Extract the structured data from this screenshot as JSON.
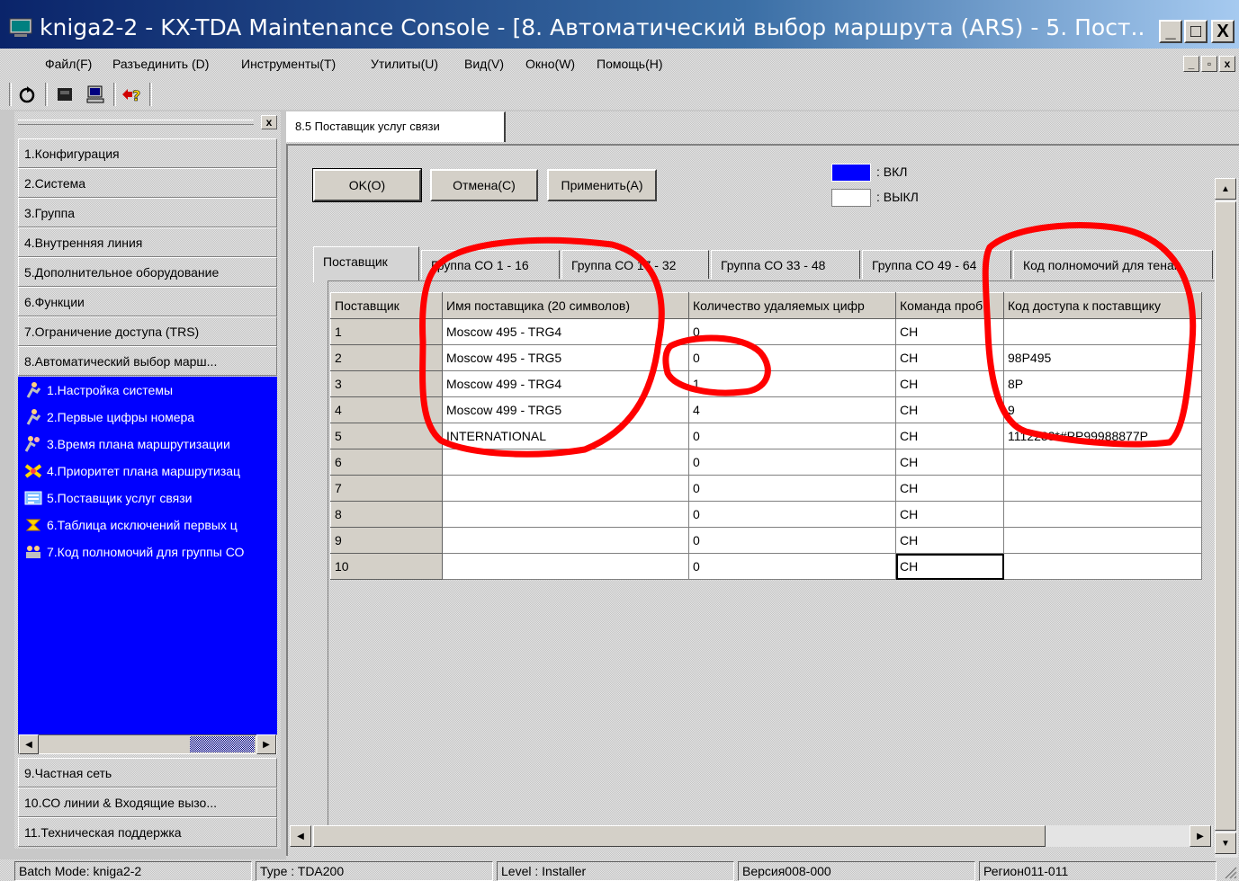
{
  "window": {
    "title": "kniga2-2 - KX-TDA Maintenance Console - [8. Автоматический выбор маршрута (ARS) - 5. Пост...",
    "minimize": "_",
    "maximize": "□",
    "close": "X"
  },
  "menu": {
    "items": [
      "Файл(F)",
      "Разъединить (D)",
      "Инструменты(T)",
      "Утилиты(U)",
      "Вид(V)",
      "Окно(W)",
      "Помощь(H)"
    ],
    "mdi_controls": [
      "_",
      "▫",
      "x"
    ]
  },
  "toolbar": {
    "icons": [
      "refresh-icon",
      "connect-icon",
      "computer-icon",
      "help-icon"
    ]
  },
  "left_panel": {
    "close": "x",
    "sections_top": [
      "1.Конфигурация",
      "2.Система",
      "3.Группа",
      "4.Внутренняя линия",
      "5.Дополнительное оборудование",
      "6.Функции",
      "7.Ограничение доступа (TRS)",
      "8.Автоматический выбор марш..."
    ],
    "tree": [
      "1.Настройка системы",
      "2.Первые цифры номера",
      "3.Время плана маршрутизации",
      "4.Приоритет плана маршрутизац",
      "5.Поставщик услуг связи",
      "6.Таблица исключений первых ц",
      "7.Код полномочий для группы СО"
    ],
    "sections_bottom": [
      "9.Частная сеть",
      "10.СО линии & Входящие вызо...",
      "11.Техническая поддержка"
    ]
  },
  "main": {
    "doc_tab": "8.5 Поставщик услуг связи",
    "buttons": {
      "ok": "OK(O)",
      "cancel": "Отмена(C)",
      "apply": "Применить(A)"
    },
    "legend": {
      "on": ": ВКЛ",
      "off": ": ВЫКЛ",
      "on_color": "#0000ff",
      "off_color": "#ffffff"
    },
    "subtabs": [
      "Поставщик",
      "Группа СО 1 - 16",
      "Группа СО 17 - 32",
      "Группа СО 33 - 48",
      "Группа СО 49 - 64",
      "Код полномочий для тенан"
    ],
    "grid": {
      "headers": [
        "Поставщик",
        "Имя поставщика (20 символов)",
        "Количество удаляемых цифр",
        "Команда проб",
        "Код доступа к поставщику"
      ],
      "rows": [
        [
          "1",
          "Moscow 495 - TRG4",
          "0",
          "CH",
          ""
        ],
        [
          "2",
          "Moscow 495 - TRG5",
          "0",
          "CH",
          "98P495"
        ],
        [
          "3",
          "Moscow 499 - TRG4",
          "1",
          "CH",
          "8P"
        ],
        [
          "4",
          "Moscow 499 - TRG5",
          "4",
          "CH",
          "9"
        ],
        [
          "5",
          "INTERNATIONAL",
          "0",
          "CH",
          "1112233*#PP99988877P"
        ],
        [
          "6",
          "",
          "0",
          "CH",
          ""
        ],
        [
          "7",
          "",
          "0",
          "CH",
          ""
        ],
        [
          "8",
          "",
          "0",
          "CH",
          ""
        ],
        [
          "9",
          "",
          "0",
          "CH",
          ""
        ],
        [
          "10",
          "",
          "0",
          "CH",
          ""
        ]
      ]
    }
  },
  "status": {
    "batch": "Batch Mode: kniga2-2",
    "type": "Type : TDA200",
    "level": "Level : Installer",
    "version": "Версия008-000",
    "region": "Регион011-011"
  },
  "colors": {
    "annotation": "#ff0000",
    "tree_bg": "#0000ff",
    "title_start": "#0a246a",
    "title_end": "#a6caf0"
  }
}
